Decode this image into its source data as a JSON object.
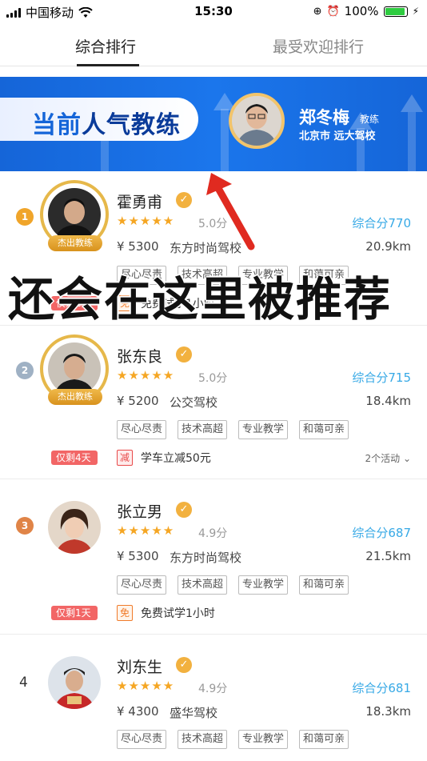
{
  "status_bar": {
    "carrier": "中国移动",
    "time": "15:30",
    "battery": "100%"
  },
  "tabs": [
    {
      "label": "综合排行",
      "active": true
    },
    {
      "label": "最受欢迎排行",
      "active": false
    }
  ],
  "banner": {
    "title_prefix": "当前",
    "title_highlight": "人气教练",
    "coach_name": "郑冬梅",
    "coach_role": "教练",
    "location": "北京市  远大驾校"
  },
  "overlay_caption": "还会在这里被推荐",
  "coaches": [
    {
      "rank": "1",
      "name": "霍勇甫",
      "avatar_tag": "杰出教练",
      "stars": "★★★★★",
      "rating": "5.0分",
      "score": "综合分770",
      "price": "¥ 5300",
      "school": "东方时尚驾校",
      "distance": "20.9km",
      "tags": [
        "尽心尽责",
        "技术高超",
        "专业教学",
        "和蔼可亲"
      ],
      "left_days": "仅剩2天",
      "promo_icon": "免",
      "promo": "免费试学1小时",
      "more": ""
    },
    {
      "rank": "2",
      "name": "张东良",
      "avatar_tag": "杰出教练",
      "stars": "★★★★★",
      "rating": "5.0分",
      "score": "综合分715",
      "price": "¥ 5200",
      "school": "公交驾校",
      "distance": "18.4km",
      "tags": [
        "尽心尽责",
        "技术高超",
        "专业教学",
        "和蔼可亲"
      ],
      "left_days": "仅剩4天",
      "promo_icon": "减",
      "promo": "学车立减50元",
      "more": "2个活动"
    },
    {
      "rank": "3",
      "name": "张立男",
      "avatar_tag": "",
      "stars": "★★★★★",
      "rating": "4.9分",
      "score": "综合分687",
      "price": "¥ 5300",
      "school": "东方时尚驾校",
      "distance": "21.5km",
      "tags": [
        "尽心尽责",
        "技术高超",
        "专业教学",
        "和蔼可亲"
      ],
      "left_days": "仅剩1天",
      "promo_icon": "免",
      "promo": "免费试学1小时",
      "more": ""
    },
    {
      "rank": "4",
      "name": "刘东生",
      "avatar_tag": "",
      "stars": "★★★★★",
      "rating": "4.9分",
      "score": "综合分681",
      "price": "¥ 4300",
      "school": "盛华驾校",
      "distance": "18.3km",
      "tags": [
        "尽心尽责",
        "技术高超",
        "专业教学",
        "和蔼可亲"
      ],
      "left_days": "",
      "promo_icon": "",
      "promo": "",
      "more": ""
    }
  ],
  "colors": {
    "accent_blue": "#1565d8",
    "score_blue": "#37a9e6",
    "star": "#f5a623",
    "gold": "#e6b84a",
    "flag_red": "#f26666"
  }
}
